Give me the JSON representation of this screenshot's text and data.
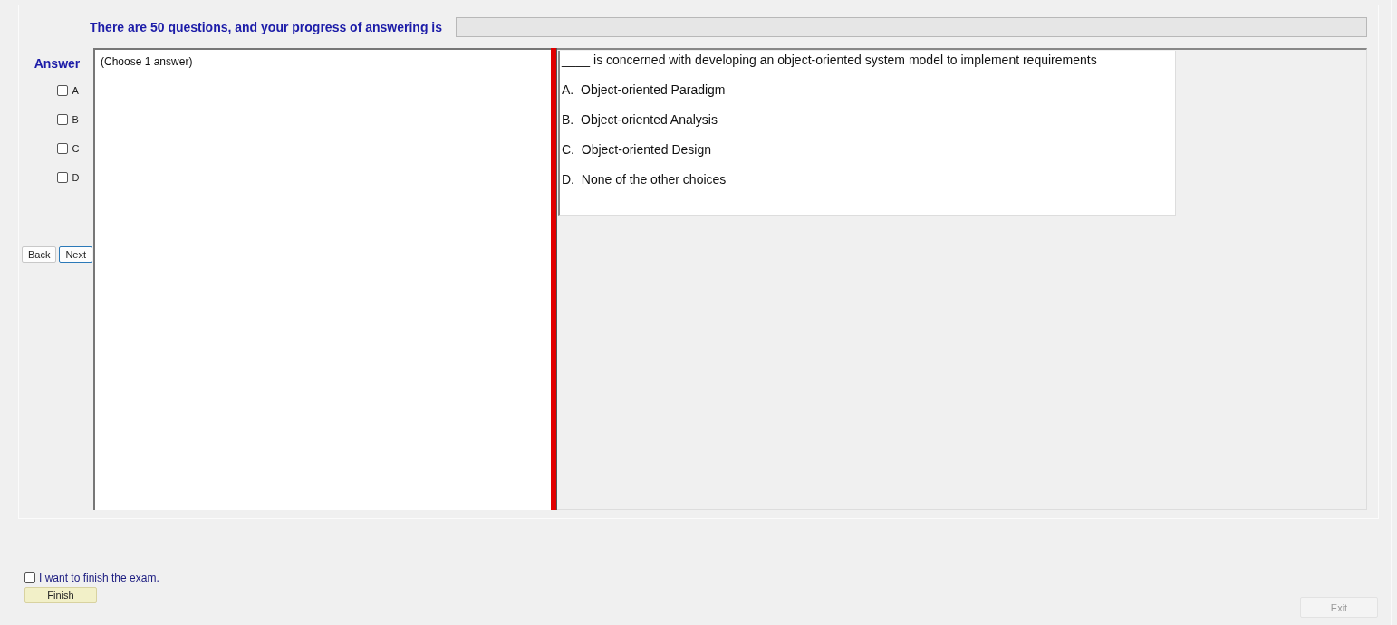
{
  "header": {
    "progress_text": "There are 50 questions, and your progress of answering is",
    "progress": {
      "level": 0
    }
  },
  "answer_panel": {
    "title": "Answer",
    "options": [
      {
        "label": "A",
        "checked": false
      },
      {
        "label": "B",
        "checked": false
      },
      {
        "label": "C",
        "checked": false
      },
      {
        "label": "D",
        "checked": false
      }
    ],
    "buttons": [
      "Back",
      "Next"
    ]
  },
  "instruction": "(Choose 1 answer)",
  "question": {
    "text": "____ is concerned with developing an object-oriented system model to implement requirements",
    "choices": [
      "A.  Object-oriented Paradigm",
      "B.  Object-oriented Analysis",
      "C.  Object-oriented Design",
      "D.  None of the other choices"
    ]
  },
  "finish": {
    "label": "I want to finish the exam.",
    "checked": false,
    "button": "Finish"
  },
  "exit_button": {
    "label": "Exit",
    "disabled": true
  }
}
